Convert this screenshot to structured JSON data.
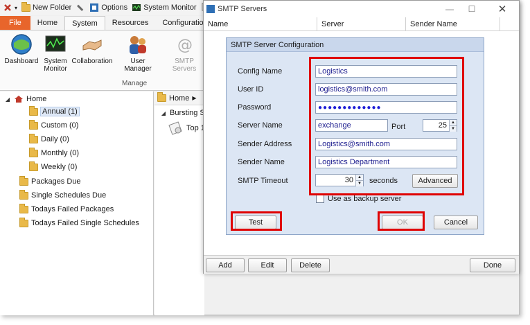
{
  "colors": {
    "file_tab": "#e8652b",
    "dialog_bg": "#dce6f4",
    "highlight_red": "#e00000",
    "field_text": "#1c1c8e"
  },
  "qat": {
    "new_folder": "New Folder",
    "options": "Options",
    "system_monitor": "System Monitor"
  },
  "ribbon": {
    "tabs": [
      "File",
      "Home",
      "System",
      "Resources",
      "Configuration"
    ],
    "active_tab": "System",
    "buttons": [
      {
        "label": "Dashboard",
        "icon": "dashboard-icon"
      },
      {
        "label": "System Monitor",
        "icon": "system-monitor-icon"
      },
      {
        "label": "Collaboration",
        "icon": "collaboration-icon"
      },
      {
        "label": "User Manager",
        "icon": "user-manager-icon"
      },
      {
        "label": "SMTP Servers",
        "icon": "smtp-servers-icon"
      }
    ],
    "group_label": "Manage"
  },
  "tree": {
    "root": "Home",
    "folders": [
      "Annual (1)",
      "Custom (0)",
      "Daily (0)",
      "Monthly (0)",
      "Weekly (0)"
    ],
    "selected": "Annual (1)",
    "sections": [
      "Packages Due",
      "Single Schedules Due",
      "Todays Failed Packages",
      "Todays Failed Single Schedules"
    ]
  },
  "middle": {
    "breadcrumb": "Home",
    "group": "Bursting S",
    "item": "Top 1"
  },
  "smtp_window": {
    "title": "SMTP Servers",
    "columns": [
      "Name",
      "Server",
      "Sender Name"
    ],
    "buttons": {
      "add": "Add",
      "edit": "Edit",
      "delete": "Delete",
      "done": "Done"
    }
  },
  "config_dialog": {
    "title": "SMTP Server Configuration",
    "labels": {
      "config_name": "Config Name",
      "user_id": "User ID",
      "password": "Password",
      "server_name": "Server Name",
      "port": "Port",
      "sender_address": "Sender Address",
      "sender_name": "Sender Name",
      "smtp_timeout": "SMTP Timeout",
      "seconds": "seconds"
    },
    "values": {
      "config_name": "Logistics",
      "user_id": "logistics@smith.com",
      "password": "●●●●●●●●●●●●●",
      "server_name": "exchange",
      "port": "25",
      "sender_address": "Logistics@smith.com",
      "sender_name": "Logistics Department",
      "smtp_timeout": "30"
    },
    "backup_checkbox": "Use as backup server",
    "backup_checked": false,
    "buttons": {
      "advanced": "Advanced",
      "test": "Test",
      "ok": "OK",
      "cancel": "Cancel"
    }
  }
}
